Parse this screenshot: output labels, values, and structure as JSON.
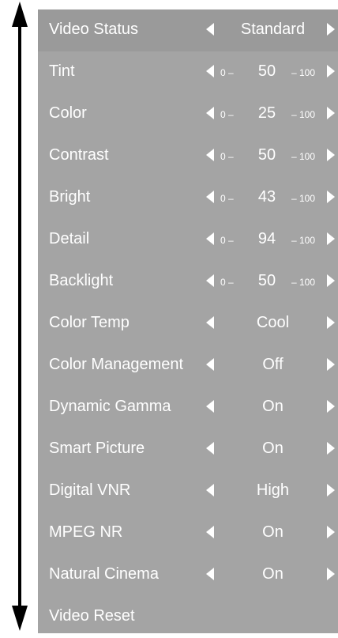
{
  "menu": {
    "video_status": {
      "label": "Video Status",
      "value": "Standard"
    },
    "tint": {
      "label": "Tint",
      "min": "0 –",
      "value": "50",
      "max": "– 100"
    },
    "color": {
      "label": "Color",
      "min": "0 –",
      "value": "25",
      "max": "– 100"
    },
    "contrast": {
      "label": "Contrast",
      "min": "0 –",
      "value": "50",
      "max": "– 100"
    },
    "bright": {
      "label": "Bright",
      "min": "0 –",
      "value": "43",
      "max": "– 100"
    },
    "detail": {
      "label": "Detail",
      "min": "0 –",
      "value": "94",
      "max": "– 100"
    },
    "backlight": {
      "label": "Backlight",
      "min": "0 –",
      "value": "50",
      "max": "– 100"
    },
    "color_temp": {
      "label": "Color Temp",
      "value": "Cool"
    },
    "color_management": {
      "label": "Color Management",
      "value": "Off"
    },
    "dynamic_gamma": {
      "label": "Dynamic Gamma",
      "value": "On"
    },
    "smart_picture": {
      "label": "Smart Picture",
      "value": "On"
    },
    "digital_vnr": {
      "label": "Digital VNR",
      "value": "High"
    },
    "mpeg_nr": {
      "label": "MPEG NR",
      "value": "On"
    },
    "natural_cinema": {
      "label": "Natural Cinema",
      "value": "On"
    },
    "video_reset": {
      "label": "Video Reset"
    }
  },
  "colors": {
    "panel": "#a4a4a4",
    "selected_row": "#9a9a9a",
    "text": "#ffffff",
    "scroll_arrow": "#000000"
  },
  "icons": {
    "scroll": "double-headed-vertical-arrow",
    "decrease": "left-triangle",
    "increase": "right-triangle"
  }
}
